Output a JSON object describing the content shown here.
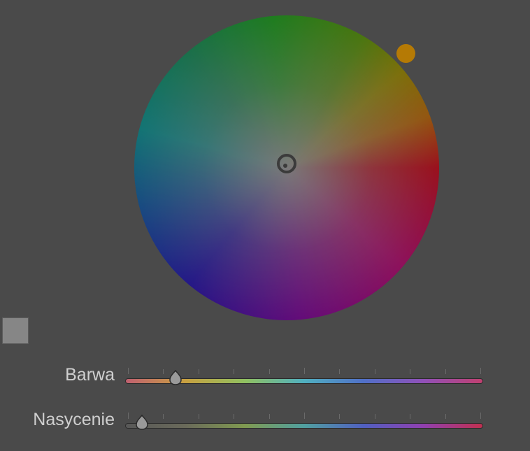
{
  "color_wheel": {
    "hue_handle_color": "#b57a05",
    "center_marker_color": "#3b3b3b"
  },
  "swatch": {
    "color": "#868686"
  },
  "sliders": {
    "hue": {
      "label": "Barwa",
      "value_fraction": 0.14,
      "track_colors": [
        "#c06070",
        "#c8a040",
        "#90c060",
        "#50b0c0",
        "#5070c8",
        "#9050b8",
        "#c04070"
      ]
    },
    "saturation": {
      "label": "Nasycenie",
      "value_fraction": 0.045,
      "track_colors": [
        "#585858",
        "#6a6a5a",
        "#809a50",
        "#50a0a0",
        "#5060c0",
        "#9040b0",
        "#c03050"
      ]
    }
  }
}
